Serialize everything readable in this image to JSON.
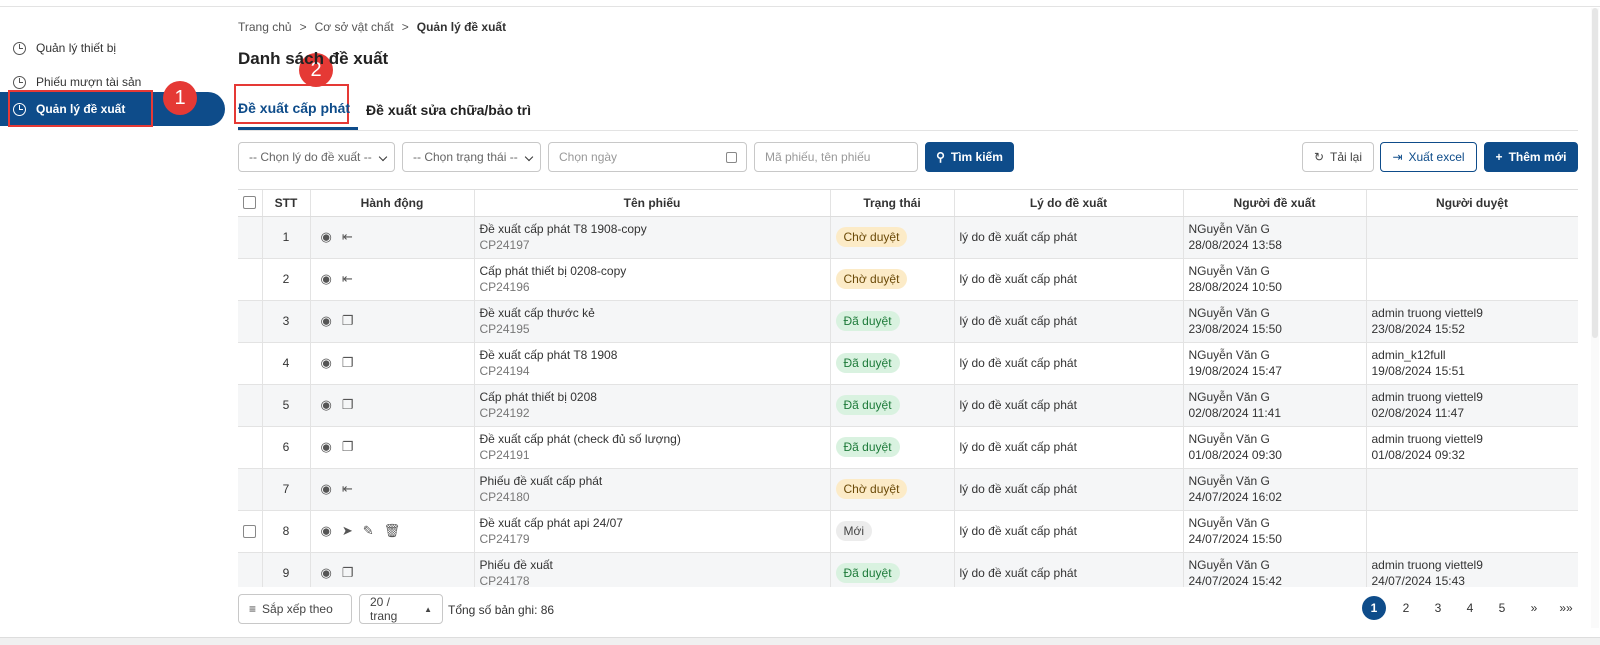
{
  "sidebar": {
    "items": [
      {
        "label": "Quản lý thiết bị"
      },
      {
        "label": "Phiếu mượn tài sản"
      },
      {
        "label": "Quản lý đề xuất"
      }
    ]
  },
  "annotations": {
    "one": "1",
    "two": "2"
  },
  "breadcrumb": {
    "home": "Trang chủ",
    "sep": ">",
    "level2": "Cơ sở vật chất",
    "current": "Quản lý đề xuất"
  },
  "page": {
    "title": "Danh sách đề xuất"
  },
  "tabs": [
    {
      "label": "Đề xuất cấp phát"
    },
    {
      "label": "Đề xuất sửa chữa/bảo trì"
    }
  ],
  "filters": {
    "reason_select": "-- Chọn lý do đề xuất --",
    "status_select": "-- Chọn trạng thái --",
    "date_placeholder": "Chọn ngày",
    "search_placeholder": "Mã phiếu, tên phiếu",
    "search_button": "Tìm kiếm",
    "reload_button": "Tải lại",
    "export_button": "Xuất excel",
    "add_button": "Thêm mới"
  },
  "table": {
    "headers": [
      "STT",
      "Hành động",
      "Tên phiếu",
      "Trạng thái",
      "Lý do đề xuất",
      "Người đề xuất",
      "Người duyệt"
    ],
    "rows": [
      {
        "stt": "1",
        "name": "Đề xuất cấp phát T8 1908-copy",
        "code": "CP24197",
        "status": "Chờ duyệt",
        "reason": "lý do đề xuất cấp phát",
        "proposer": "NGuyễn Văn G",
        "proposed_at": "28/08/2024 13:58",
        "approver": "",
        "approved_at": ""
      },
      {
        "stt": "2",
        "name": "Cấp phát thiết bị 0208-copy",
        "code": "CP24196",
        "status": "Chờ duyệt",
        "reason": "lý do đề xuất cấp phát",
        "proposer": "NGuyễn Văn G",
        "proposed_at": "28/08/2024 10:50",
        "approver": "",
        "approved_at": ""
      },
      {
        "stt": "3",
        "name": "Đề xuất cấp thước kẻ",
        "code": "CP24195",
        "status": "Đã duyệt",
        "reason": "lý do đề xuất cấp phát",
        "proposer": "NGuyễn Văn G",
        "proposed_at": "23/08/2024 15:50",
        "approver": "admin truong viettel9",
        "approved_at": "23/08/2024 15:52"
      },
      {
        "stt": "4",
        "name": "Đề xuất cấp phát T8 1908",
        "code": "CP24194",
        "status": "Đã duyệt",
        "reason": "lý do đề xuất cấp phát",
        "proposer": "NGuyễn Văn G",
        "proposed_at": "19/08/2024 15:47",
        "approver": "admin_k12full",
        "approved_at": "19/08/2024 15:51"
      },
      {
        "stt": "5",
        "name": "Cấp phát thiết bị 0208",
        "code": "CP24192",
        "status": "Đã duyệt",
        "reason": "lý do đề xuất cấp phát",
        "proposer": "NGuyễn Văn G",
        "proposed_at": "02/08/2024 11:41",
        "approver": "admin truong viettel9",
        "approved_at": "02/08/2024 11:47"
      },
      {
        "stt": "6",
        "name": "Đề xuất cấp phát (check đủ số lượng)",
        "code": "CP24191",
        "status": "Đã duyệt",
        "reason": "lý do đề xuất cấp phát",
        "proposer": "NGuyễn Văn G",
        "proposed_at": "01/08/2024 09:30",
        "approver": "admin truong viettel9",
        "approved_at": "01/08/2024 09:32"
      },
      {
        "stt": "7",
        "name": "Phiếu đề xuất cấp phát",
        "code": "CP24180",
        "status": "Chờ duyệt",
        "reason": "lý do đề xuất cấp phát",
        "proposer": "NGuyễn Văn G",
        "proposed_at": "24/07/2024 16:02",
        "approver": "",
        "approved_at": ""
      },
      {
        "stt": "8",
        "name": "Đề xuất cấp phát api 24/07",
        "code": "CP24179",
        "status": "Mới",
        "reason": "lý do đề xuất cấp phát",
        "proposer": "NGuyễn Văn G",
        "proposed_at": "24/07/2024 15:50",
        "approver": "",
        "approved_at": ""
      },
      {
        "stt": "9",
        "name": "Phiếu đề xuất",
        "code": "CP24178",
        "status": "Đã duyệt",
        "reason": "lý do đề xuất cấp phát",
        "proposer": "NGuyễn Văn G",
        "proposed_at": "24/07/2024 15:42",
        "approver": "admin truong viettel9",
        "approved_at": "24/07/2024 15:43"
      }
    ]
  },
  "footer": {
    "sort_label": "Sắp xếp theo",
    "page_size": "20 / trang",
    "total": "Tổng số bản ghi: 86",
    "pages": [
      "1",
      "2",
      "3",
      "4",
      "5",
      "»",
      "»»"
    ]
  },
  "colors": {
    "primary": "#0e4c8a",
    "annotation": "#e53935",
    "pending_bg": "#fcebc7",
    "approved_bg": "#d9f2e0"
  }
}
